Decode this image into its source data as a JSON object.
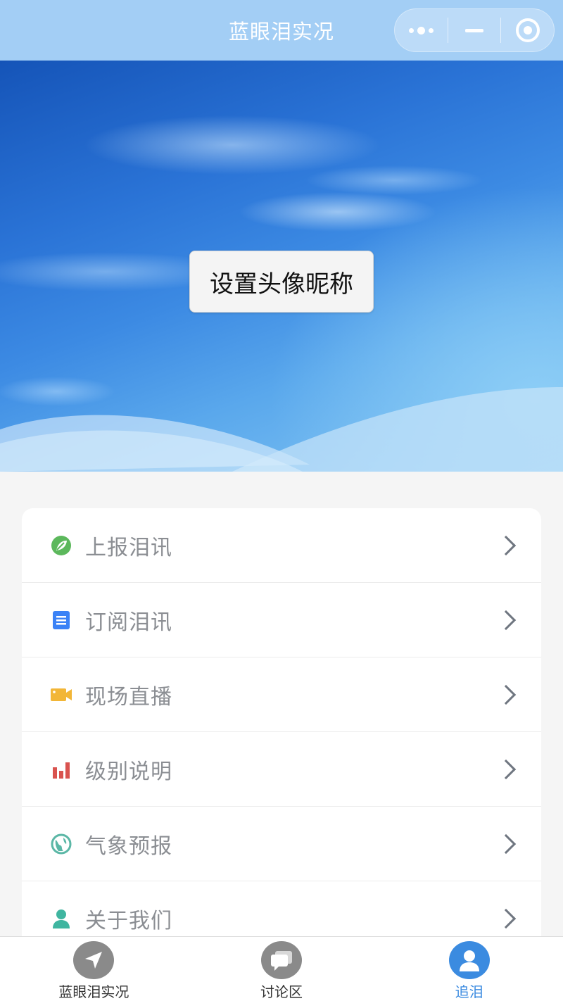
{
  "navbar": {
    "title": "蓝眼泪实况",
    "capsule": {
      "more_icon": "more-dots-icon",
      "minimize_icon": "minus-icon",
      "close_icon": "target-circle-icon"
    }
  },
  "hero": {
    "button_label": "设置头像昵称"
  },
  "menu": {
    "items": [
      {
        "label": "上报泪讯",
        "icon": "report-leaf-icon",
        "color": "#5cb85c"
      },
      {
        "label": "订阅泪讯",
        "icon": "subscribe-list-icon",
        "color": "#3b82f6"
      },
      {
        "label": "现场直播",
        "icon": "video-camera-icon",
        "color": "#f2b637"
      },
      {
        "label": "级别说明",
        "icon": "bar-chart-icon",
        "color": "#d9534f"
      },
      {
        "label": "气象预报",
        "icon": "globe-icon",
        "color": "#5bb7a6"
      },
      {
        "label": "关于我们",
        "icon": "person-icon",
        "color": "#3fb5a0"
      }
    ]
  },
  "tabbar": {
    "tabs": [
      {
        "label": "蓝眼泪实况",
        "icon": "navigation-arrow-icon",
        "active": false
      },
      {
        "label": "讨论区",
        "icon": "chat-bubble-icon",
        "active": false
      },
      {
        "label": "追泪",
        "icon": "user-profile-icon",
        "active": true
      }
    ],
    "active_color": "#3b8be0",
    "inactive_icon_color": "#8a8a8a"
  }
}
